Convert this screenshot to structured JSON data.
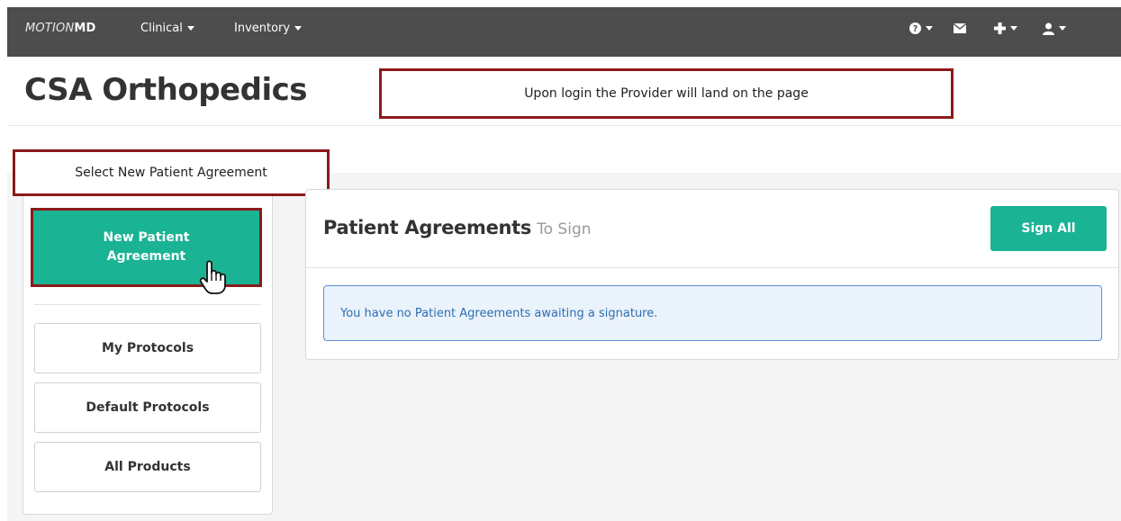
{
  "navbar": {
    "brand_light": "MOTION",
    "brand_bold": "MD",
    "menus": [
      {
        "label": "Clinical"
      },
      {
        "label": "Inventory"
      }
    ],
    "icons": [
      "help-icon",
      "envelope-icon",
      "plus-icon",
      "user-icon"
    ]
  },
  "header": {
    "title": "CSA Orthopedics"
  },
  "callouts": {
    "top": "Upon login the Provider will land on the page",
    "left": "Select New Patient Agreement"
  },
  "sidebar": {
    "new_agreement_label": "New Patient Agreement",
    "buttons": [
      {
        "label": "My Protocols"
      },
      {
        "label": "Default Protocols"
      },
      {
        "label": "All Products"
      }
    ]
  },
  "panel": {
    "title": "Patient Agreements",
    "subtitle": "To Sign",
    "sign_all_label": "Sign All",
    "alert_text": "You have no Patient Agreements awaiting a signature."
  },
  "colors": {
    "navbar": "#4d4d4d",
    "accent_green": "#1ab394",
    "callout_border": "#8b1a1a",
    "alert_text": "#2f6db2"
  }
}
